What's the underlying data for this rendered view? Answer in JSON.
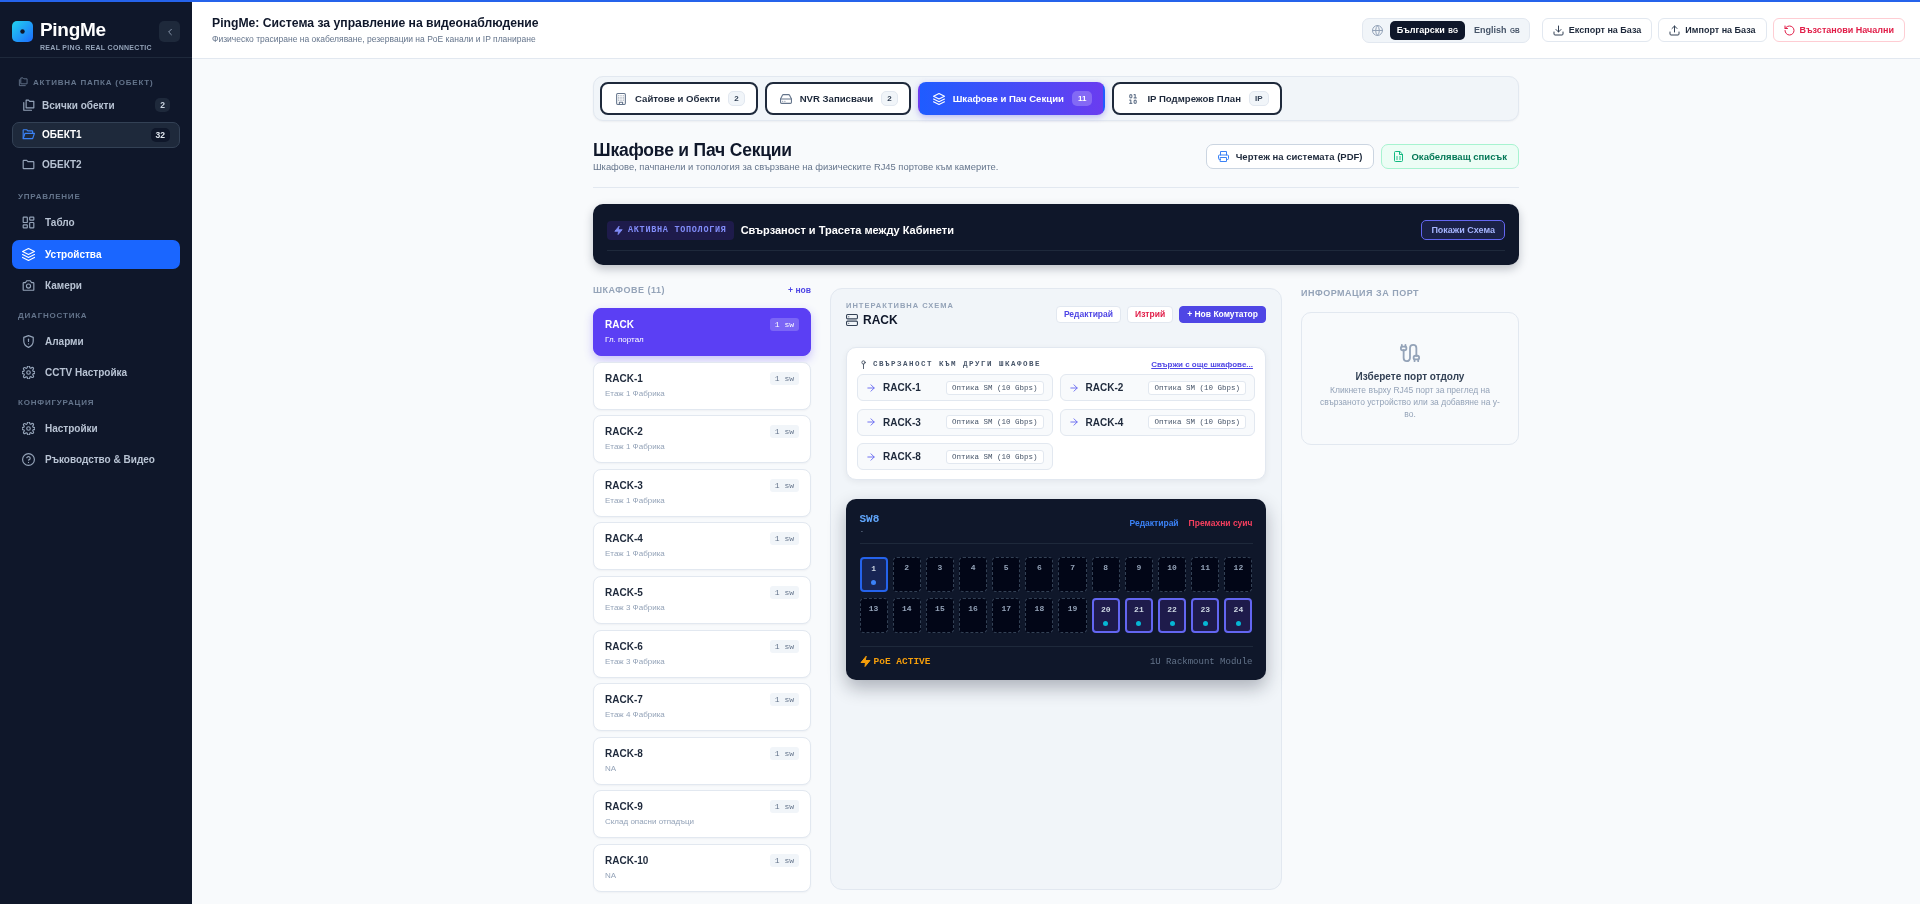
{
  "sidebar": {
    "brand": {
      "name": "PingMe",
      "tagline": "REAL PING. REAL CONNECTIC"
    },
    "sections": [
      {
        "title": "АКТИВНА ПАПКА (ОБЕКТ)",
        "kind": "folder",
        "items": [
          {
            "label": "Всички обекти",
            "count": "2",
            "selected": false
          },
          {
            "label": "ОБЕКТ1",
            "count": "32",
            "selected": true
          },
          {
            "label": "ОБЕКТ2",
            "selected": false
          }
        ]
      },
      {
        "title": "УПРАВЛЕНИЕ",
        "kind": "nav",
        "items": [
          {
            "label": "Табло",
            "selected": false
          },
          {
            "label": "Устройства",
            "selected": true
          },
          {
            "label": "Камери",
            "selected": false
          }
        ]
      },
      {
        "title": "ДИАГНОСТИКА",
        "kind": "nav",
        "items": [
          {
            "label": "Аларми",
            "selected": false
          },
          {
            "label": "CCTV Настройка",
            "selected": false
          }
        ]
      },
      {
        "title": "КОНФИГУРАЦИЯ",
        "kind": "nav",
        "items": [
          {
            "label": "Настройки",
            "selected": false
          },
          {
            "label": "Ръководство & Видео",
            "selected": false
          }
        ]
      }
    ]
  },
  "header": {
    "title": "PingMe: Система за управление на видеонаблюдение",
    "subtitle": "Физическо трасиране на окабеляване, резервации на PoE канали и IP планиране",
    "languages": [
      {
        "label": "Български",
        "code": "BG",
        "selected": true
      },
      {
        "label": "English",
        "code": "GB",
        "selected": false
      }
    ],
    "actions": [
      {
        "label": "Експорт на База",
        "kind": "export"
      },
      {
        "label": "Импорт на База",
        "kind": "import"
      },
      {
        "label": "Възстанови Начални",
        "kind": "reset"
      }
    ]
  },
  "tabs": [
    {
      "label": "Сайтове и Обекти",
      "count": "2",
      "selected": false
    },
    {
      "label": "NVR Записвачи",
      "count": "2",
      "selected": false
    },
    {
      "label": "Шкафове и Пач Секции",
      "count": "11",
      "selected": true
    },
    {
      "label": "IP Подмрежов План",
      "count": "IP",
      "selected": false
    }
  ],
  "page": {
    "title": "Шкафове и Пач Секции",
    "subtitle": "Шкафове, пачпанели и топология за свързване на физическите RJ45 портове към камерите.",
    "actions": [
      {
        "label": "Чертеж на системата (PDF)",
        "kind": "pdf"
      },
      {
        "label": "Окабеляващ списък",
        "kind": "cabling"
      }
    ]
  },
  "topology": {
    "badge": "АКТИВНА ТОПОЛОГИЯ",
    "title": "Свързаност и Трасета между Кабинети",
    "button": "Покажи Схема"
  },
  "racks": {
    "title": "ШКАФОВЕ (11)",
    "add": "+ нов",
    "items": [
      {
        "name": "RACK",
        "location": "Гл. портал",
        "count": "1 sw",
        "selected": true
      },
      {
        "name": "RACK-1",
        "location": "Етаж 1 Фабрика",
        "count": "1 sw",
        "selected": false
      },
      {
        "name": "RACK-2",
        "location": "Етаж 1 Фабрика",
        "count": "1 sw",
        "selected": false
      },
      {
        "name": "RACK-3",
        "location": "Етаж 1 Фабрика",
        "count": "1 sw",
        "selected": false
      },
      {
        "name": "RACK-4",
        "location": "Етаж 1 Фабрика",
        "count": "1 sw",
        "selected": false
      },
      {
        "name": "RACK-5",
        "location": "Етаж 3 Фабрика",
        "count": "1 sw",
        "selected": false
      },
      {
        "name": "RACK-6",
        "location": "Етаж 3 Фабрика",
        "count": "1 sw",
        "selected": false
      },
      {
        "name": "RACK-7",
        "location": "Етаж 4 Фабрика",
        "count": "1 sw",
        "selected": false
      },
      {
        "name": "RACK-8",
        "location": "NA",
        "count": "1 sw",
        "selected": false
      },
      {
        "name": "RACK-9",
        "location": "Склад опасни отпадъци",
        "count": "1 sw",
        "selected": false
      },
      {
        "name": "RACK-10",
        "location": "NA",
        "count": "1 sw",
        "selected": false
      }
    ]
  },
  "scheme": {
    "label": "ИНТЕРАКТИВНА СХЕМА",
    "name": "RACK",
    "actions": [
      {
        "label": "Редактирай",
        "kind": "edit"
      },
      {
        "label": "Изтрий",
        "kind": "delete"
      },
      {
        "label": "+ Нов Комутатор",
        "kind": "add"
      }
    ],
    "connections": {
      "title": "СВЪРЗАНОСТ КЪМ ДРУГИ ШКАФОВЕ",
      "link": "Свържи с още шкафове...",
      "items": [
        {
          "name": "RACK-1",
          "medium": "Оптика SM (10 Gbps)"
        },
        {
          "name": "RACK-2",
          "medium": "Оптика SM (10 Gbps)"
        },
        {
          "name": "RACK-3",
          "medium": "Оптика SM (10 Gbps)"
        },
        {
          "name": "RACK-4",
          "medium": "Оптика SM (10 Gbps)"
        },
        {
          "name": "RACK-8",
          "medium": "Оптика SM (10 Gbps)"
        }
      ]
    },
    "switch": {
      "name": "SW8",
      "detail": ".",
      "actions": [
        {
          "label": "Редактирай",
          "kind": "edit"
        },
        {
          "label": "Премахни суич",
          "kind": "remove"
        }
      ],
      "ports": [
        {
          "label": "1",
          "kind": "uplink"
        },
        {
          "label": "2",
          "kind": "free"
        },
        {
          "label": "3",
          "kind": "free"
        },
        {
          "label": "4",
          "kind": "free"
        },
        {
          "label": "5",
          "kind": "free"
        },
        {
          "label": "6",
          "kind": "free"
        },
        {
          "label": "7",
          "kind": "free"
        },
        {
          "label": "8",
          "kind": "free"
        },
        {
          "label": "9",
          "kind": "free"
        },
        {
          "label": "10",
          "kind": "free"
        },
        {
          "label": "11",
          "kind": "free"
        },
        {
          "label": "12",
          "kind": "free"
        },
        {
          "label": "13",
          "kind": "free"
        },
        {
          "label": "14",
          "kind": "free"
        },
        {
          "label": "15",
          "kind": "free"
        },
        {
          "label": "16",
          "kind": "free"
        },
        {
          "label": "17",
          "kind": "free"
        },
        {
          "label": "18",
          "kind": "free"
        },
        {
          "label": "19",
          "kind": "free"
        },
        {
          "label": "20",
          "kind": "linked"
        },
        {
          "label": "21",
          "kind": "linked"
        },
        {
          "label": "22",
          "kind": "linked"
        },
        {
          "label": "23",
          "kind": "linked"
        },
        {
          "label": "24",
          "kind": "linked"
        }
      ],
      "poe": "PoE ACTIVE",
      "model": "1U Rackmount Module"
    }
  },
  "port_info": {
    "title": "ИНФОРМАЦИЯ ЗА ПОРТ",
    "heading": "Изберете порт отдолу",
    "text": "Кликнете върху RJ45 порт за преглед на свързаното устройство или за добавяне на у-во."
  }
}
